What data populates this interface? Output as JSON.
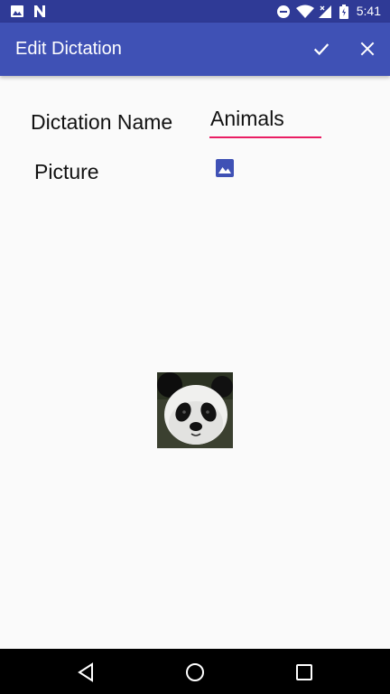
{
  "status_bar": {
    "time": "5:41",
    "left_icons": [
      "image-icon",
      "n-notification-icon"
    ],
    "right_icons": [
      "dnd-icon",
      "wifi-icon",
      "signal-icon",
      "battery-icon"
    ]
  },
  "app_bar": {
    "title": "Edit Dictation",
    "confirm_icon": "check-icon",
    "close_icon": "close-icon",
    "color": "#3f51b5"
  },
  "form": {
    "name_label": "Dictation Name",
    "name_value": "Animals",
    "picture_label": "Picture",
    "picture_icon": "image-icon",
    "accent_color": "#e91e63"
  },
  "content": {
    "selected_image": "panda-image"
  },
  "nav_bar": {
    "buttons": [
      "back-icon",
      "home-icon",
      "recents-icon"
    ]
  }
}
